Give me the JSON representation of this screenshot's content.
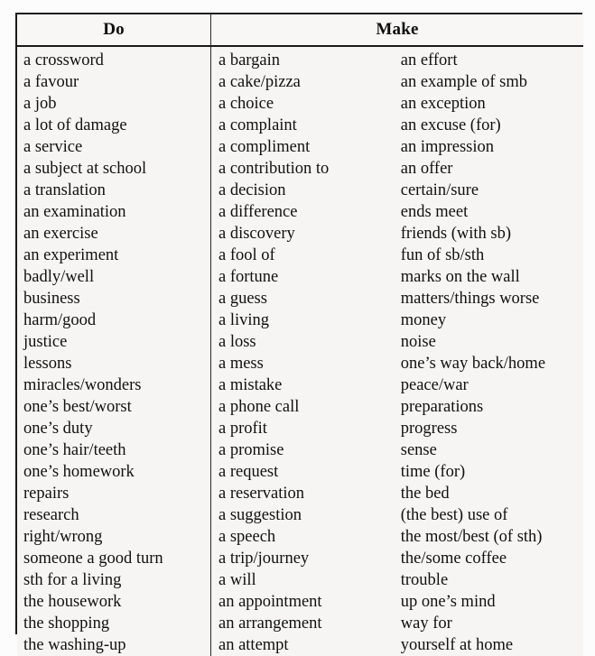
{
  "table": {
    "headers": {
      "do": "Do",
      "make": "Make"
    },
    "columns": {
      "do": [
        "a crossword",
        "a favour",
        "a job",
        "a lot of damage",
        "a service",
        "a subject at school",
        "a translation",
        "an examination",
        "an exercise",
        "an experiment",
        "badly/well",
        "business",
        "harm/good",
        "justice",
        "lessons",
        "miracles/wonders",
        "one’s best/worst",
        "one’s duty",
        "one’s hair/teeth",
        "one’s homework",
        "repairs",
        "research",
        "right/wrong",
        "someone a good turn",
        "sth for a living",
        "the housework",
        "the shopping",
        "the washing-up"
      ],
      "make_left": [
        "a bargain",
        "a cake/pizza",
        "a choice",
        "a complaint",
        "a compliment",
        "a contribution to",
        "a decision",
        "a difference",
        "a discovery",
        "a fool of",
        "a fortune",
        "a guess",
        "a living",
        "a loss",
        "a mess",
        "a mistake",
        "a phone call",
        "a profit",
        "a promise",
        "a request",
        "a reservation",
        "a suggestion",
        "a speech",
        "a trip/journey",
        "a will",
        "an appointment",
        "an arrangement",
        "an attempt"
      ],
      "make_right": [
        "an effort",
        "an example of smb",
        "an exception",
        "an excuse (for)",
        "an impression",
        "an offer",
        "certain/sure",
        "ends meet",
        "friends (with sb)",
        "fun of sb/sth",
        "marks on the wall",
        "matters/things worse",
        "money",
        "noise",
        "one’s way back/home",
        "peace/war",
        "preparations",
        "progress",
        "sense",
        "time (for)",
        "the bed",
        "(the best) use of",
        "the most/best (of sth)",
        "the/some coffee",
        "trouble",
        "up one’s mind",
        "way for",
        "yourself at home"
      ]
    }
  },
  "colors": {
    "page_background": "#fcfcfc",
    "table_background": "#f6f5f3",
    "header_background": "#f8f7f5",
    "border": "#1a1a1a",
    "text": "#111111"
  }
}
